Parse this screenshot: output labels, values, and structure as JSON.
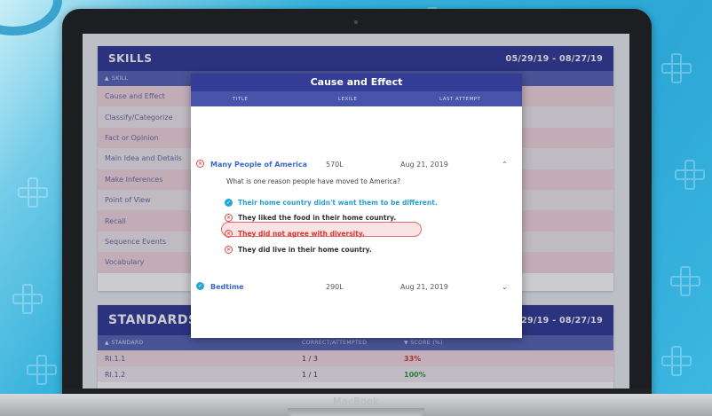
{
  "device": {
    "brand": "MacBook"
  },
  "skills": {
    "title": "SKILLS",
    "date_range": "05/29/19 - 08/27/19",
    "column": "SKILL",
    "items": [
      "Cause and Effect",
      "Classify/Categorize",
      "Fact or Opinion",
      "Main Idea and Details",
      "Make Inferences",
      "Point of View",
      "Recall",
      "Sequence Events",
      "Vocabulary"
    ]
  },
  "standards": {
    "title": "STANDARDS",
    "date_range": "05/29/19 - 08/27/19",
    "columns": {
      "standard": "STANDARD",
      "correct": "CORRECT/ATTEMPTED",
      "score": "SCORE (%)"
    },
    "rows": [
      {
        "standard": "RI.1.1",
        "correct": "1 / 3",
        "score": "33%"
      },
      {
        "standard": "RI.1.2",
        "correct": "1 / 1",
        "score": "100%"
      }
    ]
  },
  "modal": {
    "title": "Cause and Effect",
    "columns": {
      "title": "TITLE",
      "lexile": "LEXILE",
      "last_attempt": "LAST ATTEMPT"
    },
    "items": [
      {
        "title": "Many People of America",
        "lexile": "570L",
        "date": "Aug 21, 2019",
        "status": "incorrect",
        "expanded": true,
        "question": "What is one reason people have moved to America?",
        "answers": [
          {
            "text": "Their home country didn't want them to be different.",
            "state": "correct"
          },
          {
            "text": "They liked the food in their home country.",
            "state": "incorrect"
          },
          {
            "text": "They did not agree with diversity.",
            "state": "chosen"
          },
          {
            "text": "They did live in their home country.",
            "state": "incorrect"
          }
        ]
      },
      {
        "title": "Bedtime",
        "lexile": "290L",
        "date": "Aug 21, 2019",
        "status": "correct",
        "expanded": false
      }
    ]
  },
  "colors": {
    "header": "#343d96",
    "correct": "#22a7d6",
    "incorrect": "#e04545",
    "score_low": "#d13a3a",
    "score_high": "#2e9e3e"
  }
}
